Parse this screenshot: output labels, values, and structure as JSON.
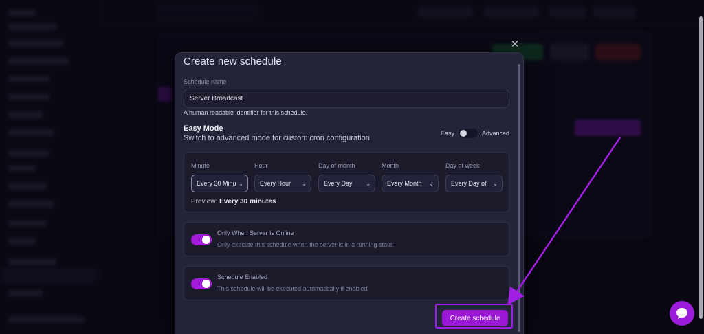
{
  "modal": {
    "title": "Create new schedule",
    "name_label": "Schedule name",
    "name_value": "Server Broadcast",
    "name_help": "A human readable identifier for this schedule.",
    "easy_title": "Easy Mode",
    "easy_desc": "Switch to advanced mode for custom cron configuration",
    "easy_left": "Easy",
    "easy_right": "Advanced",
    "cron": [
      {
        "label": "Minute",
        "value": "Every 30 Minu"
      },
      {
        "label": "Hour",
        "value": "Every Hour"
      },
      {
        "label": "Day of month",
        "value": "Every Day"
      },
      {
        "label": "Month",
        "value": "Every Month"
      },
      {
        "label": "Day of week",
        "value": "Every Day of"
      }
    ],
    "preview_label": "Preview:",
    "preview_value": "Every 30 minutes",
    "option1_title": "Only When Server Is Online",
    "option1_desc": "Only execute this schedule when the server is in a running state.",
    "option2_title": "Schedule Enabled",
    "option2_desc": "This schedule will be executed automatically if enabled.",
    "submit_label": "Create schedule",
    "close_symbol": "✕"
  },
  "colors": {
    "accent": "#9b18d8",
    "modal_bg": "#242438"
  }
}
